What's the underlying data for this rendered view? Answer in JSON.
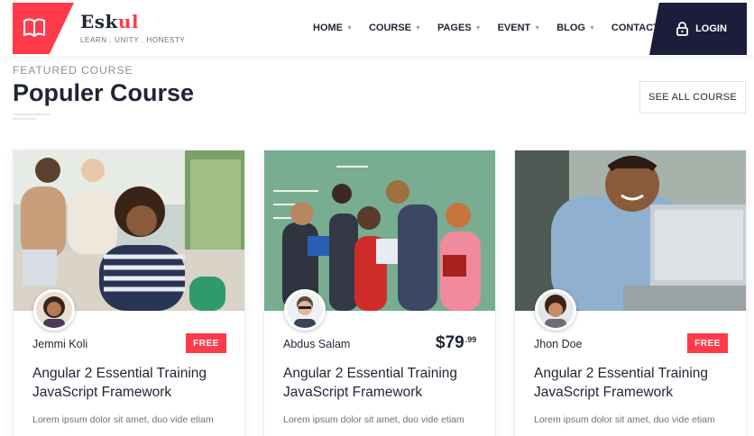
{
  "header": {
    "brand_main": "Esk",
    "brand_accent": "ul",
    "tagline": "LEARN . UNITY . HONESTY",
    "nav": [
      {
        "label": "HOME",
        "has_dropdown": true
      },
      {
        "label": "COURSE",
        "has_dropdown": true
      },
      {
        "label": "PAGES",
        "has_dropdown": true
      },
      {
        "label": "EVENT",
        "has_dropdown": true
      },
      {
        "label": "BLOG",
        "has_dropdown": true
      },
      {
        "label": "CONTACT US",
        "has_dropdown": false
      }
    ],
    "login_label": "LOGIN",
    "brand_color": "#ff3b4b",
    "login_bg": "#1b1d3a"
  },
  "section": {
    "eyebrow": "FEATURED COURSE",
    "title": "Populer Course",
    "see_all_label": "SEE ALL COURSE"
  },
  "cards": [
    {
      "instructor": "Jemmi Koli",
      "price_badge": "FREE",
      "title": "Angular 2 Essential Training JavaScript Framework",
      "description": "Lorem ipsum dolor sit amet, duo vide etiam"
    },
    {
      "instructor": "Abdus Salam",
      "price_main": "$79",
      "price_cents": ".99",
      "title": "Angular 2 Essential Training JavaScript Framework",
      "description": "Lorem ipsum dolor sit amet, duo vide etiam"
    },
    {
      "instructor": "Jhon Doe",
      "price_badge": "FREE",
      "title": "Angular 2 Essential Training JavaScript Framework",
      "description": "Lorem ipsum dolor sit amet, duo vide etiam"
    }
  ],
  "icons": {
    "logo": "open-book-icon",
    "login": "lock-icon",
    "dropdown": "caret-down-icon"
  }
}
